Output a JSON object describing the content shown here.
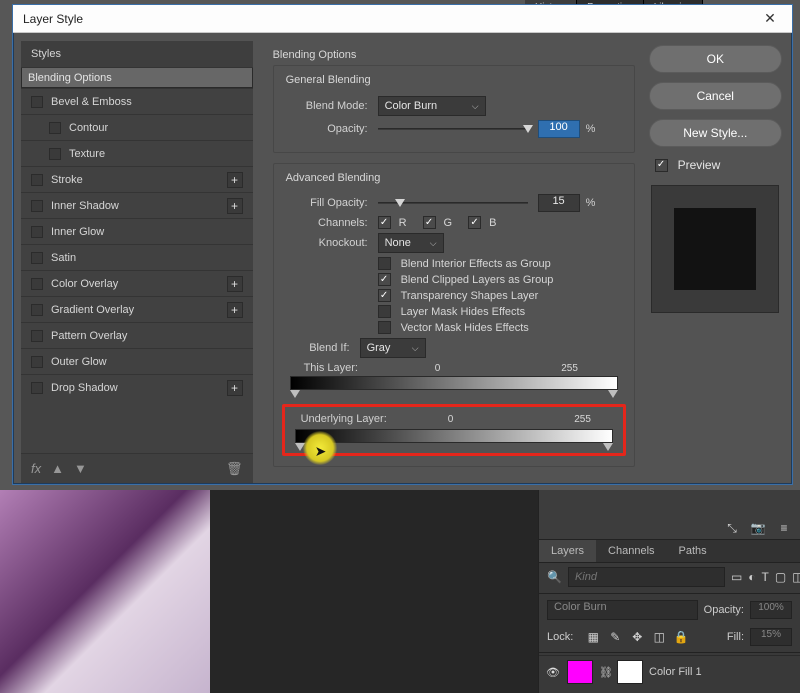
{
  "dialog": {
    "title": "Layer Style",
    "close_glyph": "✕",
    "left": {
      "header": "Styles",
      "rows": [
        {
          "id": "blending-options",
          "label": "Blending Options",
          "checkbox": false,
          "plus": false,
          "selected": true,
          "sub": false
        },
        {
          "id": "bevel",
          "label": "Bevel & Emboss",
          "checkbox": true,
          "plus": false,
          "selected": false,
          "sub": false
        },
        {
          "id": "contour",
          "label": "Contour",
          "checkbox": true,
          "plus": false,
          "selected": false,
          "sub": true
        },
        {
          "id": "texture",
          "label": "Texture",
          "checkbox": true,
          "plus": false,
          "selected": false,
          "sub": true
        },
        {
          "id": "stroke",
          "label": "Stroke",
          "checkbox": true,
          "plus": true,
          "selected": false,
          "sub": false
        },
        {
          "id": "inner-shadow",
          "label": "Inner Shadow",
          "checkbox": true,
          "plus": true,
          "selected": false,
          "sub": false
        },
        {
          "id": "inner-glow",
          "label": "Inner Glow",
          "checkbox": true,
          "plus": false,
          "selected": false,
          "sub": false
        },
        {
          "id": "satin",
          "label": "Satin",
          "checkbox": true,
          "plus": false,
          "selected": false,
          "sub": false
        },
        {
          "id": "color-overlay",
          "label": "Color Overlay",
          "checkbox": true,
          "plus": true,
          "selected": false,
          "sub": false
        },
        {
          "id": "gradient-overlay",
          "label": "Gradient Overlay",
          "checkbox": true,
          "plus": true,
          "selected": false,
          "sub": false
        },
        {
          "id": "pattern-overlay",
          "label": "Pattern Overlay",
          "checkbox": true,
          "plus": false,
          "selected": false,
          "sub": false
        },
        {
          "id": "outer-glow",
          "label": "Outer Glow",
          "checkbox": true,
          "plus": false,
          "selected": false,
          "sub": false
        },
        {
          "id": "drop-shadow",
          "label": "Drop Shadow",
          "checkbox": true,
          "plus": true,
          "selected": false,
          "sub": false
        }
      ],
      "footer": {
        "fx": "fx",
        "up": "▲",
        "down": "▼",
        "trash": "🗑"
      }
    },
    "mid": {
      "section_title": "Blending Options",
      "general": {
        "title": "General Blending",
        "blend_mode_label": "Blend Mode:",
        "blend_mode": "Color Burn",
        "opacity_label": "Opacity:",
        "opacity": "100",
        "opacity_knob_pct": 100,
        "pct": "%"
      },
      "advanced": {
        "title": "Advanced Blending",
        "fill_opacity_label": "Fill Opacity:",
        "fill_opacity": "15",
        "fill_opacity_knob_pct": 15,
        "pct": "%",
        "channels_label": "Channels:",
        "ch_r": "R",
        "ch_g": "G",
        "ch_b": "B",
        "knockout_label": "Knockout:",
        "knockout": "None",
        "opts": [
          {
            "on": false,
            "label": "Blend Interior Effects as Group"
          },
          {
            "on": true,
            "label": "Blend Clipped Layers as Group"
          },
          {
            "on": true,
            "label": "Transparency Shapes Layer"
          },
          {
            "on": false,
            "label": "Layer Mask Hides Effects"
          },
          {
            "on": false,
            "label": "Vector Mask Hides Effects"
          }
        ]
      },
      "blendif": {
        "label": "Blend If:",
        "channel": "Gray",
        "this_label": "This Layer:",
        "this_lo": "0",
        "this_hi": "255",
        "under_label": "Underlying Layer:",
        "under_lo": "0",
        "under_hi": "255"
      }
    },
    "right": {
      "ok": "OK",
      "cancel": "Cancel",
      "new_style": "New Style...",
      "preview": "Preview"
    }
  },
  "bg_tabs": {
    "t1": "History",
    "t2": "Properties",
    "t3": "Libraries"
  },
  "dock": {
    "tabs": {
      "layers": "Layers",
      "channels": "Channels",
      "paths": "Paths"
    },
    "search_placeholder": "Kind",
    "blend_mode": "Color Burn",
    "opacity_label": "Opacity:",
    "opacity": "100%",
    "lock_label": "Lock:",
    "fill_label": "Fill:",
    "fill": "15%",
    "layer_name": "Color Fill 1"
  }
}
